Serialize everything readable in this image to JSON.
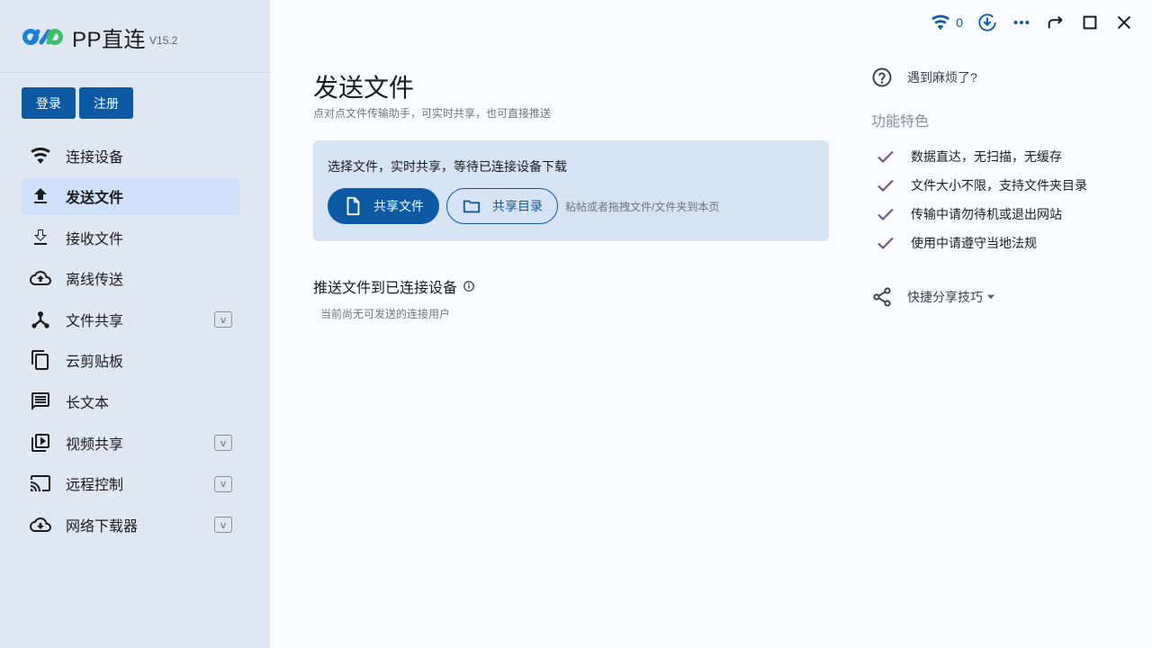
{
  "app": {
    "name": "PP直连",
    "version": "V15.2"
  },
  "auth": {
    "login": "登录",
    "register": "注册"
  },
  "sidebar": {
    "items": [
      {
        "label": "连接设备",
        "icon": "wifi-icon",
        "active": false,
        "expandable": false
      },
      {
        "label": "发送文件",
        "icon": "upload-icon",
        "active": true,
        "expandable": false
      },
      {
        "label": "接收文件",
        "icon": "download-icon",
        "active": false,
        "expandable": false
      },
      {
        "label": "离线传送",
        "icon": "cloud-upload-icon",
        "active": false,
        "expandable": false
      },
      {
        "label": "文件共享",
        "icon": "share-hub-icon",
        "active": false,
        "expandable": true
      },
      {
        "label": "云剪贴板",
        "icon": "clipboard-copy-icon",
        "active": false,
        "expandable": false
      },
      {
        "label": "长文本",
        "icon": "message-text-icon",
        "active": false,
        "expandable": false
      },
      {
        "label": "视频共享",
        "icon": "video-library-icon",
        "active": false,
        "expandable": true
      },
      {
        "label": "远程控制",
        "icon": "cast-icon",
        "active": false,
        "expandable": true
      },
      {
        "label": "网络下载器",
        "icon": "cloud-download-icon",
        "active": false,
        "expandable": true
      }
    ],
    "expand_glyph": "v"
  },
  "titlebar": {
    "connection_count": "0"
  },
  "main": {
    "title": "发送文件",
    "subtitle": "点对点文件传输助手，可实时共享，也可直接推送",
    "share_card": {
      "hint": "选择文件，实时共享，等待已连接设备下载",
      "share_file": "共享文件",
      "share_folder": "共享目录",
      "drop_hint": "粘帖或者拖拽文件/文件夹到本页"
    },
    "push": {
      "title": "推送文件到已连接设备",
      "empty": "当前尚无可发送的连接用户"
    }
  },
  "right": {
    "help": "遇到麻烦了?",
    "features_title": "功能特色",
    "features": [
      "数据直达，无扫描，无缓存",
      "文件大小不限，支持文件夹目录",
      "传输中请勿待机或退出网站",
      "使用中请遵守当地法规"
    ],
    "tips": "快捷分享技巧"
  },
  "colors": {
    "accent": "#0b5aa3",
    "sidebar_bg": "#dfe7f3",
    "active_bg": "#cfe0fb",
    "card_bg": "#d5e3f5",
    "check": "#6a5a82",
    "logo_blue": "#1e7fd8",
    "logo_green": "#3fbf6a"
  }
}
